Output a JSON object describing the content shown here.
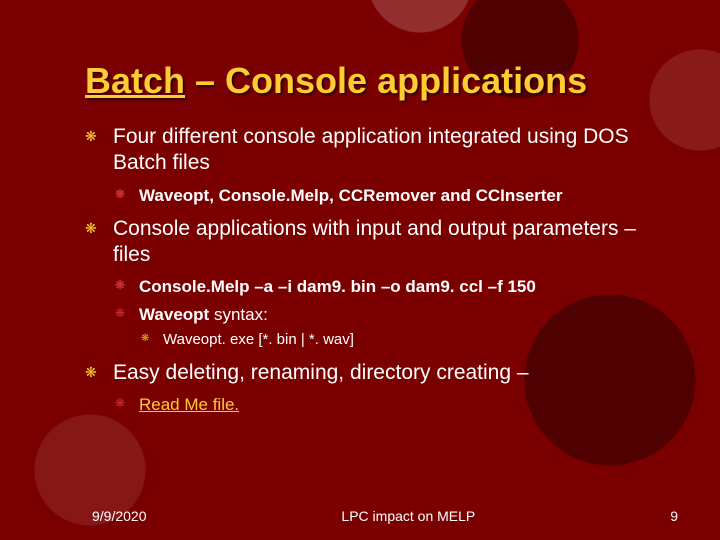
{
  "title": {
    "underlined": "Batch",
    "rest": " – Console applications"
  },
  "bullets": [
    {
      "text": "Four different console application integrated using DOS Batch files",
      "sub": [
        {
          "text": "Waveopt, Console.Melp, CCRemover and CCInserter",
          "bold": true
        }
      ]
    },
    {
      "text": "Console applications with input and output parameters – files",
      "sub": [
        {
          "text": "Console.Melp –a –i dam9. bin –o dam9. ccl –f 150",
          "bold": true
        },
        {
          "text_prefix_bold": "Waveopt",
          "text_rest": " syntax:",
          "sub": [
            {
              "text": "Waveopt. exe [*. bin | *. wav]"
            }
          ]
        }
      ]
    },
    {
      "text": "Easy deleting, renaming, directory creating –",
      "sub": [
        {
          "linktext": "Read Me file."
        }
      ]
    }
  ],
  "footer": {
    "date": "9/9/2020",
    "center": "LPC impact on MELP",
    "page": "9"
  }
}
